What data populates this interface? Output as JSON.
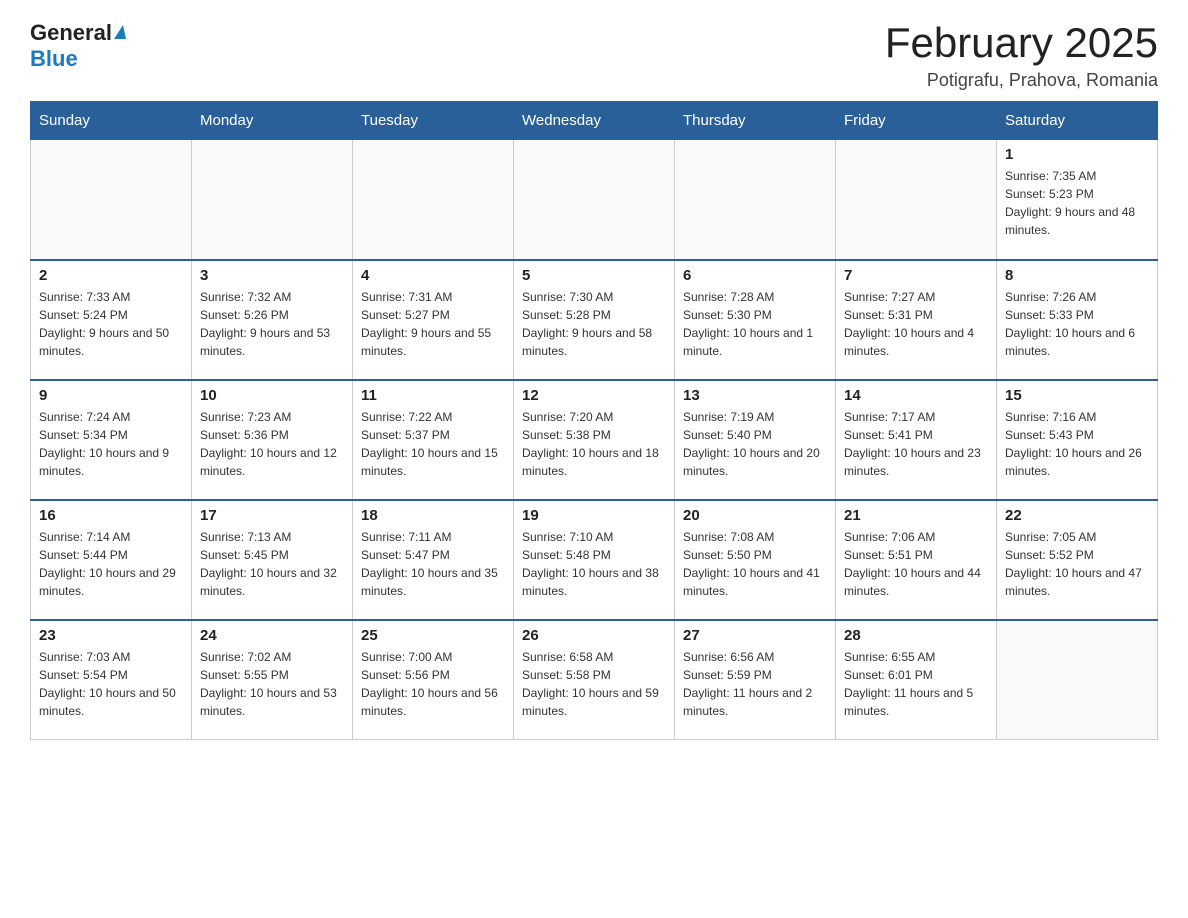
{
  "header": {
    "logo_general": "General",
    "logo_blue": "Blue",
    "month_title": "February 2025",
    "location": "Potigrafu, Prahova, Romania"
  },
  "weekdays": [
    "Sunday",
    "Monday",
    "Tuesday",
    "Wednesday",
    "Thursday",
    "Friday",
    "Saturday"
  ],
  "weeks": [
    [
      {
        "day": "",
        "info": ""
      },
      {
        "day": "",
        "info": ""
      },
      {
        "day": "",
        "info": ""
      },
      {
        "day": "",
        "info": ""
      },
      {
        "day": "",
        "info": ""
      },
      {
        "day": "",
        "info": ""
      },
      {
        "day": "1",
        "info": "Sunrise: 7:35 AM\nSunset: 5:23 PM\nDaylight: 9 hours and 48 minutes."
      }
    ],
    [
      {
        "day": "2",
        "info": "Sunrise: 7:33 AM\nSunset: 5:24 PM\nDaylight: 9 hours and 50 minutes."
      },
      {
        "day": "3",
        "info": "Sunrise: 7:32 AM\nSunset: 5:26 PM\nDaylight: 9 hours and 53 minutes."
      },
      {
        "day": "4",
        "info": "Sunrise: 7:31 AM\nSunset: 5:27 PM\nDaylight: 9 hours and 55 minutes."
      },
      {
        "day": "5",
        "info": "Sunrise: 7:30 AM\nSunset: 5:28 PM\nDaylight: 9 hours and 58 minutes."
      },
      {
        "day": "6",
        "info": "Sunrise: 7:28 AM\nSunset: 5:30 PM\nDaylight: 10 hours and 1 minute."
      },
      {
        "day": "7",
        "info": "Sunrise: 7:27 AM\nSunset: 5:31 PM\nDaylight: 10 hours and 4 minutes."
      },
      {
        "day": "8",
        "info": "Sunrise: 7:26 AM\nSunset: 5:33 PM\nDaylight: 10 hours and 6 minutes."
      }
    ],
    [
      {
        "day": "9",
        "info": "Sunrise: 7:24 AM\nSunset: 5:34 PM\nDaylight: 10 hours and 9 minutes."
      },
      {
        "day": "10",
        "info": "Sunrise: 7:23 AM\nSunset: 5:36 PM\nDaylight: 10 hours and 12 minutes."
      },
      {
        "day": "11",
        "info": "Sunrise: 7:22 AM\nSunset: 5:37 PM\nDaylight: 10 hours and 15 minutes."
      },
      {
        "day": "12",
        "info": "Sunrise: 7:20 AM\nSunset: 5:38 PM\nDaylight: 10 hours and 18 minutes."
      },
      {
        "day": "13",
        "info": "Sunrise: 7:19 AM\nSunset: 5:40 PM\nDaylight: 10 hours and 20 minutes."
      },
      {
        "day": "14",
        "info": "Sunrise: 7:17 AM\nSunset: 5:41 PM\nDaylight: 10 hours and 23 minutes."
      },
      {
        "day": "15",
        "info": "Sunrise: 7:16 AM\nSunset: 5:43 PM\nDaylight: 10 hours and 26 minutes."
      }
    ],
    [
      {
        "day": "16",
        "info": "Sunrise: 7:14 AM\nSunset: 5:44 PM\nDaylight: 10 hours and 29 minutes."
      },
      {
        "day": "17",
        "info": "Sunrise: 7:13 AM\nSunset: 5:45 PM\nDaylight: 10 hours and 32 minutes."
      },
      {
        "day": "18",
        "info": "Sunrise: 7:11 AM\nSunset: 5:47 PM\nDaylight: 10 hours and 35 minutes."
      },
      {
        "day": "19",
        "info": "Sunrise: 7:10 AM\nSunset: 5:48 PM\nDaylight: 10 hours and 38 minutes."
      },
      {
        "day": "20",
        "info": "Sunrise: 7:08 AM\nSunset: 5:50 PM\nDaylight: 10 hours and 41 minutes."
      },
      {
        "day": "21",
        "info": "Sunrise: 7:06 AM\nSunset: 5:51 PM\nDaylight: 10 hours and 44 minutes."
      },
      {
        "day": "22",
        "info": "Sunrise: 7:05 AM\nSunset: 5:52 PM\nDaylight: 10 hours and 47 minutes."
      }
    ],
    [
      {
        "day": "23",
        "info": "Sunrise: 7:03 AM\nSunset: 5:54 PM\nDaylight: 10 hours and 50 minutes."
      },
      {
        "day": "24",
        "info": "Sunrise: 7:02 AM\nSunset: 5:55 PM\nDaylight: 10 hours and 53 minutes."
      },
      {
        "day": "25",
        "info": "Sunrise: 7:00 AM\nSunset: 5:56 PM\nDaylight: 10 hours and 56 minutes."
      },
      {
        "day": "26",
        "info": "Sunrise: 6:58 AM\nSunset: 5:58 PM\nDaylight: 10 hours and 59 minutes."
      },
      {
        "day": "27",
        "info": "Sunrise: 6:56 AM\nSunset: 5:59 PM\nDaylight: 11 hours and 2 minutes."
      },
      {
        "day": "28",
        "info": "Sunrise: 6:55 AM\nSunset: 6:01 PM\nDaylight: 11 hours and 5 minutes."
      },
      {
        "day": "",
        "info": ""
      }
    ]
  ]
}
